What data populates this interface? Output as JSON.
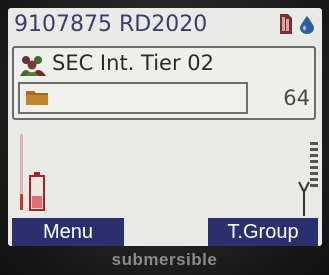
{
  "status_bar": {
    "radio_id": "9107875 RD2020",
    "icons": [
      "sim-card-icon",
      "water-drop-icon"
    ]
  },
  "talkgroup": {
    "name": "SEC Int. Tier 02",
    "icon": "group-icon"
  },
  "channel": {
    "icon": "folder-icon",
    "number": "64"
  },
  "indicators": {
    "battery": "battery-icon",
    "signal": "signal-strength-icon"
  },
  "softkeys": {
    "left": "Menu",
    "right": "T.Group"
  },
  "brand": "submersible",
  "colors": {
    "accent": "#2a2f6e",
    "id_text": "#3b3d73",
    "battery_low": "#c0392b",
    "screen_bg": "#e9e9e6"
  }
}
